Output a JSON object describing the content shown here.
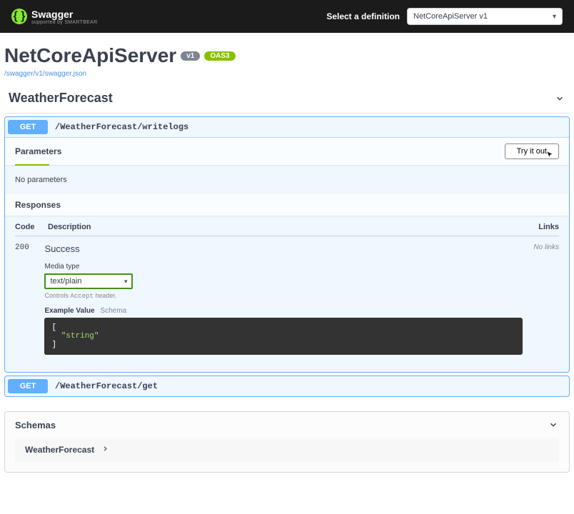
{
  "topbar": {
    "brand": "Swagger",
    "brand_sub": "supported by SMARTBEAR",
    "select_label": "Select a definition",
    "definition_selected": "NetCoreApiServer v1"
  },
  "info": {
    "title": "NetCoreApiServer",
    "version": "v1",
    "oas": "OAS3",
    "spec_url": "/swagger/v1/swagger.json"
  },
  "tag": {
    "name": "WeatherForecast"
  },
  "op_expanded": {
    "method": "GET",
    "path": "/WeatherForecast/writelogs",
    "parameters_heading": "Parameters",
    "try_label": "Try it out",
    "no_params": "No parameters",
    "responses_heading": "Responses",
    "thead_code": "Code",
    "thead_desc": "Description",
    "thead_links": "Links",
    "resp_code": "200",
    "resp_text": "Success",
    "media_label": "Media type",
    "media_selected": "text/plain",
    "media_hint_pre": "Controls ",
    "media_hint_code": "Accept",
    "media_hint_post": " header.",
    "tab_example": "Example Value",
    "tab_schema": "Schema",
    "example_body_open": "[",
    "example_body_value": "\"string\"",
    "example_body_close": "]",
    "links_val": "No links"
  },
  "op_collapsed": {
    "method": "GET",
    "path": "/WeatherForecast/get"
  },
  "schemas": {
    "heading": "Schemas",
    "items": [
      "WeatherForecast"
    ]
  }
}
